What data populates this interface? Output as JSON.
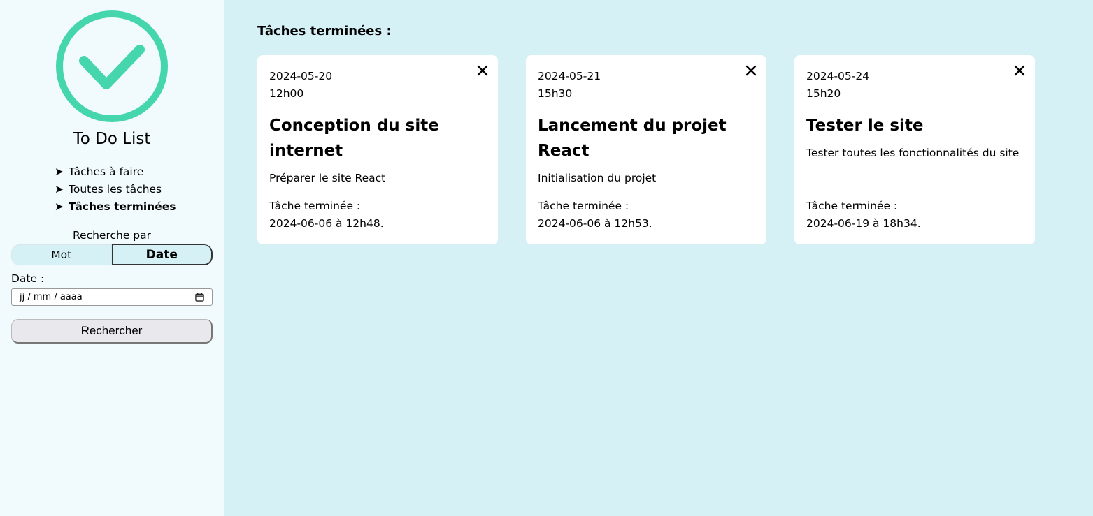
{
  "app": {
    "title": "To Do List"
  },
  "colors": {
    "accent": "#45d6ad",
    "main_bg": "#d6f1f6",
    "sidebar_bg": "#f1fbfd"
  },
  "sidebar": {
    "nav": [
      {
        "label": "Tâches à faire",
        "active": false
      },
      {
        "label": "Toutes les tâches",
        "active": false
      },
      {
        "label": "Tâches terminées",
        "active": true
      }
    ],
    "search_by_label": "Recherche par",
    "toggle": {
      "mot": "Mot",
      "date": "Date",
      "selected": "Date"
    },
    "date_label": "Date :",
    "date_placeholder": "jj / mm / aaaa",
    "search_button": "Rechercher"
  },
  "main": {
    "title": "Tâches terminées :",
    "cards": [
      {
        "date": "2024-05-20",
        "time": "12h00",
        "title": "Conception du site internet",
        "description": "Préparer le site React",
        "done_label": "Tâche terminée :",
        "done_at": "2024-06-06 à 12h48."
      },
      {
        "date": "2024-05-21",
        "time": "15h30",
        "title": "Lancement du projet React",
        "description": "Initialisation du projet",
        "done_label": "Tâche terminée :",
        "done_at": "2024-06-06 à 12h53."
      },
      {
        "date": "2024-05-24",
        "time": "15h20",
        "title": "Tester le site",
        "description": "Tester toutes les fonctionnalités du site",
        "done_label": "Tâche terminée :",
        "done_at": "2024-06-19 à 18h34."
      }
    ]
  }
}
